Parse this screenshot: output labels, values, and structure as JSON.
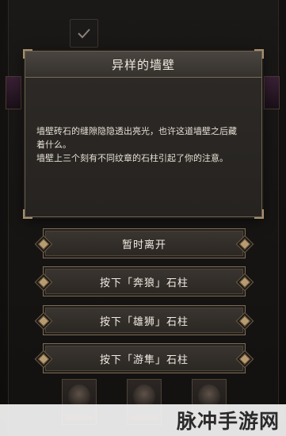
{
  "dialog": {
    "title": "异样的墙壁",
    "lines": [
      "墙壁砖石的缝隙隐隐透出亮光，也许这道墙壁之后藏",
      "着什么。",
      "墙壁上三个刻有不同纹章的石柱引起了你的注意。"
    ]
  },
  "options": [
    {
      "label": "暂时离开"
    },
    {
      "label": "按下「奔狼」石柱"
    },
    {
      "label": "按下「雄狮」石柱"
    },
    {
      "label": "按下「游隼」石柱"
    }
  ],
  "watermark": "脉冲手游网",
  "icons": {
    "top": "checkmark-icon"
  }
}
